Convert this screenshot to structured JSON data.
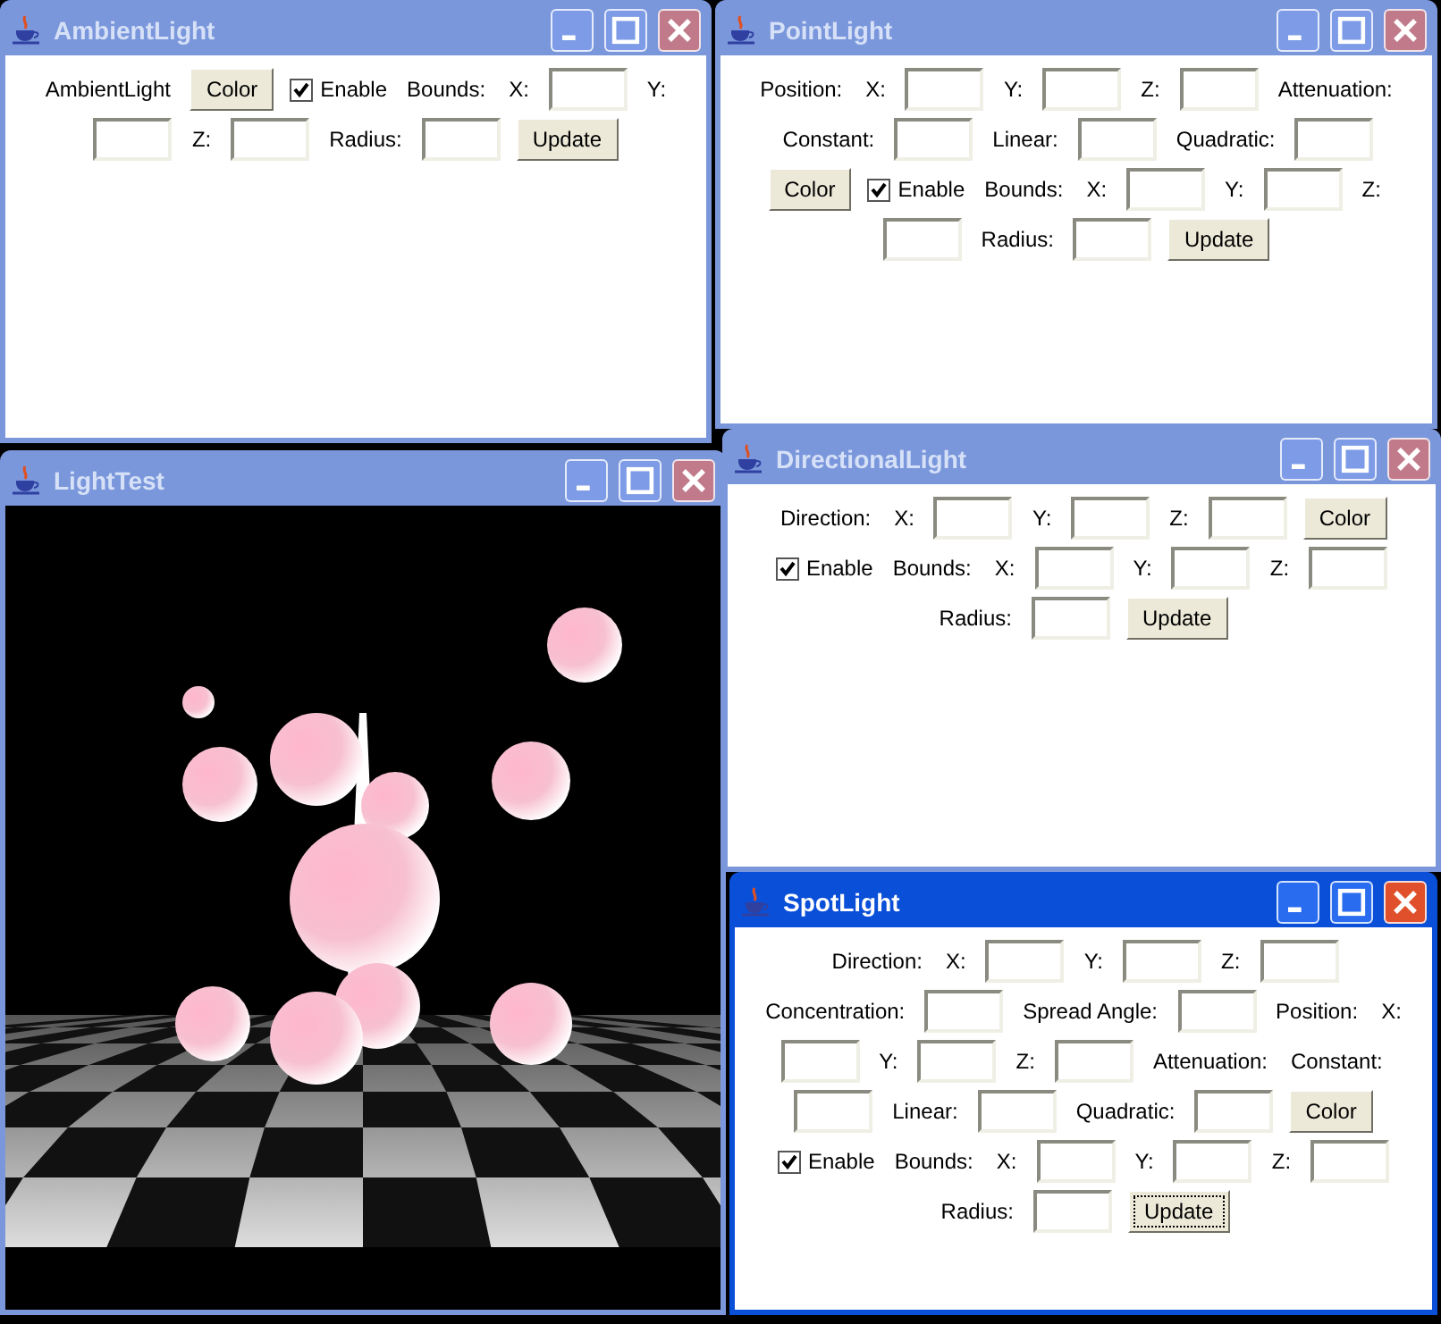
{
  "windows": [
    {
      "title": "AmbientLight",
      "active": false,
      "kind": "controls",
      "controls": [
        {
          "kind": "label",
          "text": "AmbientLight"
        },
        {
          "kind": "button",
          "label": "Color",
          "focused": false
        },
        {
          "kind": "checkbox",
          "label": "Enable",
          "checked": true
        },
        {
          "kind": "label",
          "text": "Bounds:"
        },
        {
          "kind": "label",
          "text": "X:"
        },
        {
          "kind": "field"
        },
        {
          "kind": "label",
          "text": "Y:"
        },
        {
          "kind": "field"
        },
        {
          "kind": "label",
          "text": "Z:"
        },
        {
          "kind": "field"
        },
        {
          "kind": "label",
          "text": "Radius:"
        },
        {
          "kind": "field"
        },
        {
          "kind": "button",
          "label": "Update",
          "focused": false
        }
      ]
    },
    {
      "title": "PointLight",
      "active": false,
      "kind": "controls",
      "controls": [
        {
          "kind": "label",
          "text": "Position:"
        },
        {
          "kind": "label",
          "text": "X:"
        },
        {
          "kind": "field"
        },
        {
          "kind": "label",
          "text": "Y:"
        },
        {
          "kind": "field"
        },
        {
          "kind": "label",
          "text": "Z:"
        },
        {
          "kind": "field"
        },
        {
          "kind": "label",
          "text": "Attenuation:"
        },
        {
          "kind": "label",
          "text": "Constant:"
        },
        {
          "kind": "field"
        },
        {
          "kind": "label",
          "text": "Linear:"
        },
        {
          "kind": "field"
        },
        {
          "kind": "label",
          "text": "Quadratic:"
        },
        {
          "kind": "field"
        },
        {
          "kind": "button",
          "label": "Color",
          "focused": false
        },
        {
          "kind": "checkbox",
          "label": "Enable",
          "checked": true
        },
        {
          "kind": "label",
          "text": "Bounds:"
        },
        {
          "kind": "label",
          "text": "X:"
        },
        {
          "kind": "field"
        },
        {
          "kind": "label",
          "text": "Y:"
        },
        {
          "kind": "field"
        },
        {
          "kind": "label",
          "text": "Z:"
        },
        {
          "kind": "field"
        },
        {
          "kind": "label",
          "text": "Radius:"
        },
        {
          "kind": "field"
        },
        {
          "kind": "button",
          "label": "Update",
          "focused": false
        }
      ]
    },
    {
      "title": "DirectionalLight",
      "active": false,
      "kind": "controls",
      "controls": [
        {
          "kind": "label",
          "text": "Direction:"
        },
        {
          "kind": "label",
          "text": "X:"
        },
        {
          "kind": "field"
        },
        {
          "kind": "label",
          "text": "Y:"
        },
        {
          "kind": "field"
        },
        {
          "kind": "label",
          "text": "Z:"
        },
        {
          "kind": "field"
        },
        {
          "kind": "button",
          "label": "Color",
          "focused": false
        },
        {
          "kind": "checkbox",
          "label": "Enable",
          "checked": true
        },
        {
          "kind": "label",
          "text": "Bounds:"
        },
        {
          "kind": "label",
          "text": "X:"
        },
        {
          "kind": "field"
        },
        {
          "kind": "label",
          "text": "Y:"
        },
        {
          "kind": "field"
        },
        {
          "kind": "label",
          "text": "Z:"
        },
        {
          "kind": "field"
        },
        {
          "kind": "label",
          "text": "Radius:"
        },
        {
          "kind": "field"
        },
        {
          "kind": "button",
          "label": "Update",
          "focused": false
        }
      ]
    },
    {
      "title": "LightTest",
      "active": false,
      "kind": "canvas"
    },
    {
      "title": "SpotLight",
      "active": true,
      "kind": "controls",
      "controls": [
        {
          "kind": "label",
          "text": "Direction:"
        },
        {
          "kind": "label",
          "text": "X:"
        },
        {
          "kind": "field"
        },
        {
          "kind": "label",
          "text": "Y:"
        },
        {
          "kind": "field"
        },
        {
          "kind": "label",
          "text": "Z:"
        },
        {
          "kind": "field"
        },
        {
          "kind": "label",
          "text": "Concentration:"
        },
        {
          "kind": "field"
        },
        {
          "kind": "label",
          "text": "Spread Angle:"
        },
        {
          "kind": "field"
        },
        {
          "kind": "label",
          "text": "Position:"
        },
        {
          "kind": "label",
          "text": "X:"
        },
        {
          "kind": "field"
        },
        {
          "kind": "label",
          "text": "Y:"
        },
        {
          "kind": "field"
        },
        {
          "kind": "label",
          "text": "Z:"
        },
        {
          "kind": "field"
        },
        {
          "kind": "label",
          "text": "Attenuation:"
        },
        {
          "kind": "label",
          "text": "Constant:"
        },
        {
          "kind": "field"
        },
        {
          "kind": "label",
          "text": "Linear:"
        },
        {
          "kind": "field"
        },
        {
          "kind": "label",
          "text": "Quadratic:"
        },
        {
          "kind": "field"
        },
        {
          "kind": "button",
          "label": "Color",
          "focused": false
        },
        {
          "kind": "checkbox",
          "label": "Enable",
          "checked": true
        },
        {
          "kind": "label",
          "text": "Bounds:"
        },
        {
          "kind": "label",
          "text": "X:"
        },
        {
          "kind": "field"
        },
        {
          "kind": "label",
          "text": "Y:"
        },
        {
          "kind": "field"
        },
        {
          "kind": "label",
          "text": "Z:"
        },
        {
          "kind": "field"
        },
        {
          "kind": "label",
          "text": "Radius:"
        },
        {
          "kind": "field"
        },
        {
          "kind": "button",
          "label": "Update",
          "focused": true
        }
      ]
    }
  ]
}
